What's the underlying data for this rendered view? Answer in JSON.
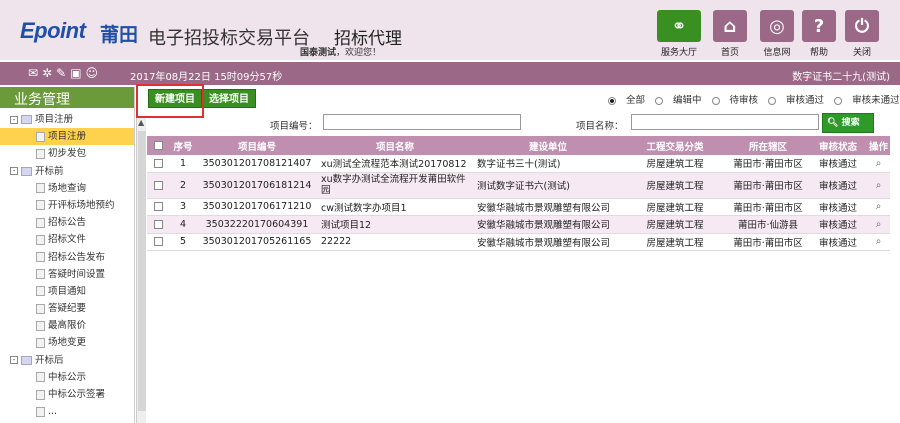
{
  "brand": {
    "logo": "Epoint",
    "city": "莆田",
    "platform": "电子招投标交易平台",
    "subsystem": "招标代理"
  },
  "welcome": {
    "user": "国泰测试",
    "text": "，欢迎您！"
  },
  "header_buttons": [
    {
      "label": "服务大厅",
      "icon": "service-hall-icon",
      "color": "#3a8f22"
    },
    {
      "label": "首页",
      "icon": "home-icon",
      "color": "#9b6887"
    },
    {
      "label": "信息网",
      "icon": "globe-icon",
      "color": "#9b6887"
    },
    {
      "label": "帮助",
      "icon": "help-icon",
      "color": "#9b6887"
    },
    {
      "label": "关闭",
      "icon": "power-icon",
      "color": "#9b6887"
    }
  ],
  "infobar": {
    "datetime": "2017年08月22日 15时09分57秒",
    "cert": "数字证书二十九(测试)"
  },
  "sidebar": {
    "title": "业务管理",
    "tree": [
      {
        "label": "项目注册",
        "level": 0,
        "expanded": true
      },
      {
        "label": "项目注册",
        "level": 1,
        "selected": true
      },
      {
        "label": "初步发包",
        "level": 1
      },
      {
        "label": "开标前",
        "level": 0,
        "expanded": true
      },
      {
        "label": "场地查询",
        "level": 1
      },
      {
        "label": "开评标场地预约",
        "level": 1
      },
      {
        "label": "招标公告",
        "level": 1
      },
      {
        "label": "招标文件",
        "level": 1
      },
      {
        "label": "招标公告发布",
        "level": 1
      },
      {
        "label": "答疑时间设置",
        "level": 1
      },
      {
        "label": "项目通知",
        "level": 1
      },
      {
        "label": "答疑纪要",
        "level": 1
      },
      {
        "label": "最高限价",
        "level": 1
      },
      {
        "label": "场地变更",
        "level": 1
      },
      {
        "label": "开标后",
        "level": 0,
        "expanded": true
      },
      {
        "label": "中标公示",
        "level": 1
      },
      {
        "label": "中标公示签署",
        "level": 1
      },
      {
        "label": "...",
        "level": 1
      }
    ]
  },
  "toolbar": {
    "new_project": "新建项目",
    "select_project": "选择项目"
  },
  "filters": {
    "options": [
      "全部",
      "编辑中",
      "待审核",
      "审核通过",
      "审核未通过"
    ],
    "selected": "全部"
  },
  "search": {
    "code_label": "项目编号：",
    "name_label": "项目名称：",
    "button": "搜索",
    "button_sub": "SEARCH"
  },
  "table": {
    "headers": [
      "序号",
      "项目编号",
      "项目名称",
      "建设单位",
      "工程交易分类",
      "所在辖区",
      "审核状态",
      "操作"
    ],
    "rows": [
      {
        "no": "1",
        "code": "350301201708121407",
        "name": "xu测试全流程范本测试20170812",
        "unit": "数字证书三十(测试)",
        "category": "房屋建筑工程",
        "region": "莆田市·莆田市区",
        "status": "审核通过"
      },
      {
        "no": "2",
        "code": "350301201706181214",
        "name": "xu数字办测试全流程开发莆田软件园",
        "unit": "测试数字证书六(测试)",
        "category": "房屋建筑工程",
        "region": "莆田市·莆田市区",
        "status": "审核通过"
      },
      {
        "no": "3",
        "code": "350301201706171210",
        "name": "cw测试数字办项目1",
        "unit": "安徽华融城市景观雕塑有限公司",
        "category": "房屋建筑工程",
        "region": "莆田市·莆田市区",
        "status": "审核通过"
      },
      {
        "no": "4",
        "code": "35032220170604391",
        "name": "测试项目12",
        "unit": "安徽华融城市景观雕塑有限公司",
        "category": "房屋建筑工程",
        "region": "莆田市·仙游县",
        "status": "审核通过"
      },
      {
        "no": "5",
        "code": "350301201705261165",
        "name": "22222",
        "unit": "安徽华融城市景观雕塑有限公司",
        "category": "房屋建筑工程",
        "region": "莆田市·莆田市区",
        "status": "审核通过"
      }
    ]
  },
  "colors": {
    "accent": "#9b6887",
    "green": "#3a8f22",
    "selected": "#ffd24d",
    "highlight_box": "#e03030"
  }
}
